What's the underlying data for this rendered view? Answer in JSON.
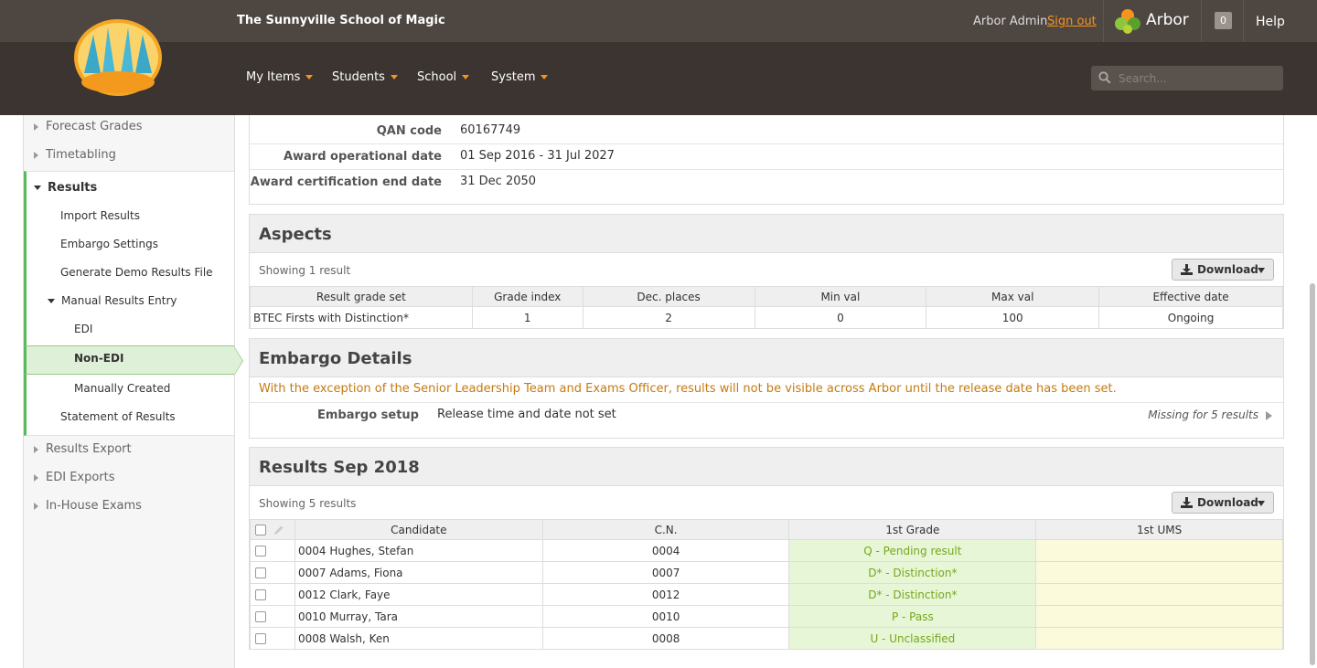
{
  "header": {
    "school_name": "The Sunnyville School of Magic",
    "user": "Arbor Admin",
    "sign_out": "Sign out",
    "brand": "Arbor",
    "notifications": "0",
    "help": "Help",
    "search_placeholder": "Search...",
    "nav": [
      "My Items",
      "Students",
      "School",
      "System"
    ]
  },
  "sidebar": {
    "forecast": "Forecast Grades",
    "timetabling": "Timetabling",
    "results": "Results",
    "import_results": "Import Results",
    "embargo_settings": "Embargo Settings",
    "generate_demo": "Generate Demo Results File",
    "manual_entry": "Manual Results Entry",
    "edi": "EDI",
    "non_edi": "Non-EDI",
    "manually_created": "Manually Created",
    "statement": "Statement of Results",
    "results_export": "Results Export",
    "edi_exports": "EDI Exports",
    "in_house": "In-House Exams"
  },
  "details": {
    "qan_label": "QAN code",
    "qan_value": "60167749",
    "award_op_label": "Award operational date",
    "award_op_value": "01 Sep 2016 - 31 Jul 2027",
    "award_cert_label": "Award certification end date",
    "award_cert_value": "31 Dec 2050"
  },
  "aspects": {
    "title": "Aspects",
    "showing": "Showing 1 result",
    "download": "Download",
    "columns": [
      "Result grade set",
      "Grade index",
      "Dec. places",
      "Min val",
      "Max val",
      "Effective date"
    ],
    "row": [
      "BTEC Firsts with Distinction*",
      "1",
      "2",
      "0",
      "100",
      "Ongoing"
    ]
  },
  "embargo": {
    "title": "Embargo Details",
    "warning": "With the exception of the Senior Leadership Team and Exams Officer, results will not be visible across Arbor until the release date has been set.",
    "setup_label": "Embargo setup",
    "setup_value": "Release time and date not set",
    "missing": "Missing for 5 results"
  },
  "results": {
    "title": "Results Sep 2018",
    "showing": "Showing 5 results",
    "download": "Download",
    "columns": [
      "Candidate",
      "C.N.",
      "1st Grade",
      "1st UMS"
    ],
    "rows": [
      {
        "candidate": "0004 Hughes, Stefan",
        "cn": "0004",
        "grade": "Q - Pending result",
        "ums": ""
      },
      {
        "candidate": "0007 Adams, Fiona",
        "cn": "0007",
        "grade": "D* - Distinction*",
        "ums": ""
      },
      {
        "candidate": "0012 Clark, Faye",
        "cn": "0012",
        "grade": "D* - Distinction*",
        "ums": ""
      },
      {
        "candidate": "0010 Murray, Tara",
        "cn": "0010",
        "grade": "P - Pass",
        "ums": ""
      },
      {
        "candidate": "0008 Walsh, Ken",
        "cn": "0008",
        "grade": "U - Unclassified",
        "ums": ""
      }
    ]
  },
  "colors": {
    "accent_orange": "#f7941d",
    "active_green": "#5cb85c",
    "header_dark": "#3b3430"
  }
}
